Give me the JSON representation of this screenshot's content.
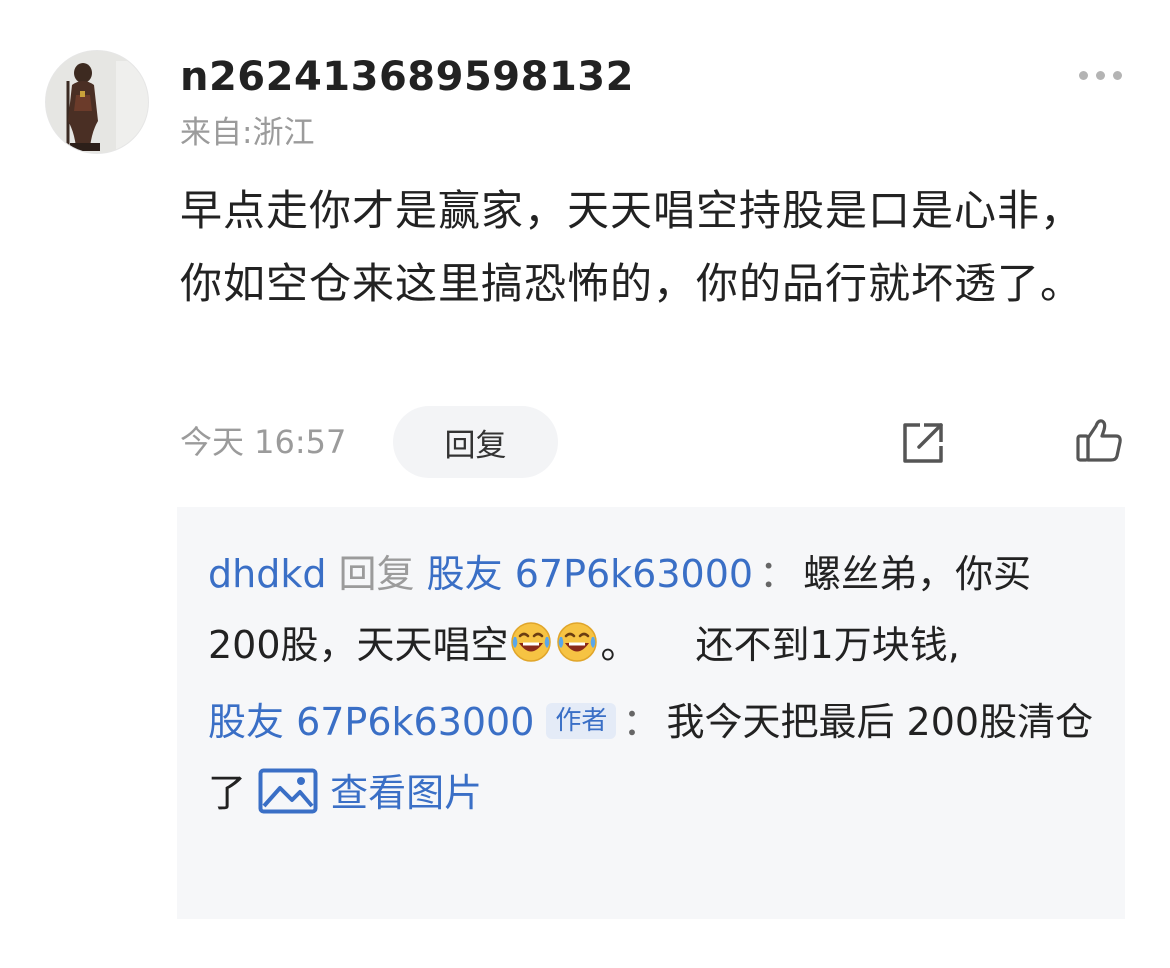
{
  "comment": {
    "username": "n262413689598132",
    "location": "来自:浙江",
    "text": "早点走你才是赢家，天天唱空持股是口是心非，你如空仓来这里搞恐怖的，你的品行就坏透了。",
    "timestamp": "今天 16:57",
    "reply_label": "回复",
    "icons": {
      "avatar": "avatar",
      "more": "more-dots-icon",
      "share": "share-icon",
      "like": "thumbs-up-icon"
    }
  },
  "replies": [
    {
      "from": "dhdkd",
      "action": "回复",
      "to": "股友 67P6k63000",
      "separator": "：",
      "text_before_emoji": "螺丝弟，你买 200股，天天唱空",
      "emoji": [
        "laughing-crying-emoji",
        "laughing-crying-emoji"
      ],
      "text_after_emoji": "。　　还不到1万块钱,"
    },
    {
      "from": "股友 67P6k63000",
      "badge": "作者",
      "separator": "：",
      "text": "我今天把最后 200股清仓了",
      "link_icon": "image-icon",
      "link_text": "查看图片"
    }
  ],
  "colors": {
    "link_blue": "#3a6fc6",
    "muted_grey": "#9b9b9b",
    "reply_box_bg": "#f6f7f9",
    "reply_button_bg": "#f3f4f6"
  }
}
